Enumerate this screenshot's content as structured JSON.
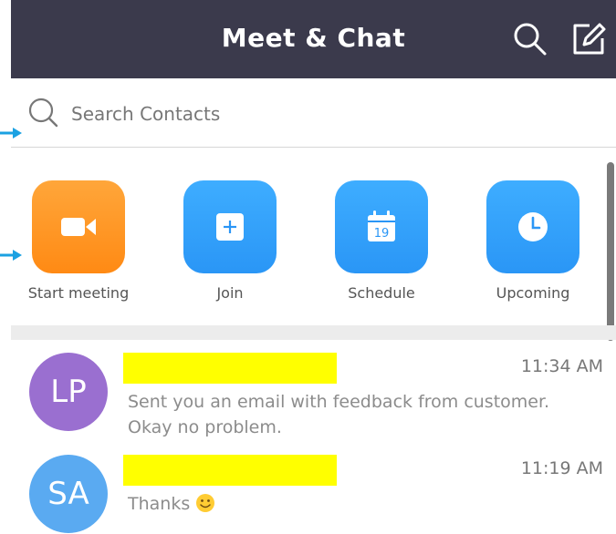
{
  "header": {
    "title": "Meet & Chat",
    "search_icon": "search-icon",
    "compose_icon": "compose-icon",
    "background": "#3b3a4c"
  },
  "search": {
    "placeholder": "Search Contacts"
  },
  "actions": [
    {
      "label": "Start meeting",
      "icon": "video-camera-icon",
      "color": "#ff9a2a"
    },
    {
      "label": "Join",
      "icon": "plus-icon",
      "color": "#349ff8"
    },
    {
      "label": "Schedule",
      "icon": "calendar-icon",
      "calendar_day": "19",
      "color": "#349ff8"
    },
    {
      "label": "Upcoming",
      "icon": "clock-icon",
      "color": "#349ff8"
    }
  ],
  "chats": [
    {
      "initials": "LP",
      "avatar_color": "#9a6fd0",
      "time": "11:34 AM",
      "message_line1": "Sent you an email with feedback from customer.",
      "message_line2": "Okay no problem."
    },
    {
      "initials": "SA",
      "avatar_color": "#5aaaf1",
      "time": "11:19 AM",
      "message": "Thanks",
      "emoji": "smiley-emoji"
    }
  ]
}
